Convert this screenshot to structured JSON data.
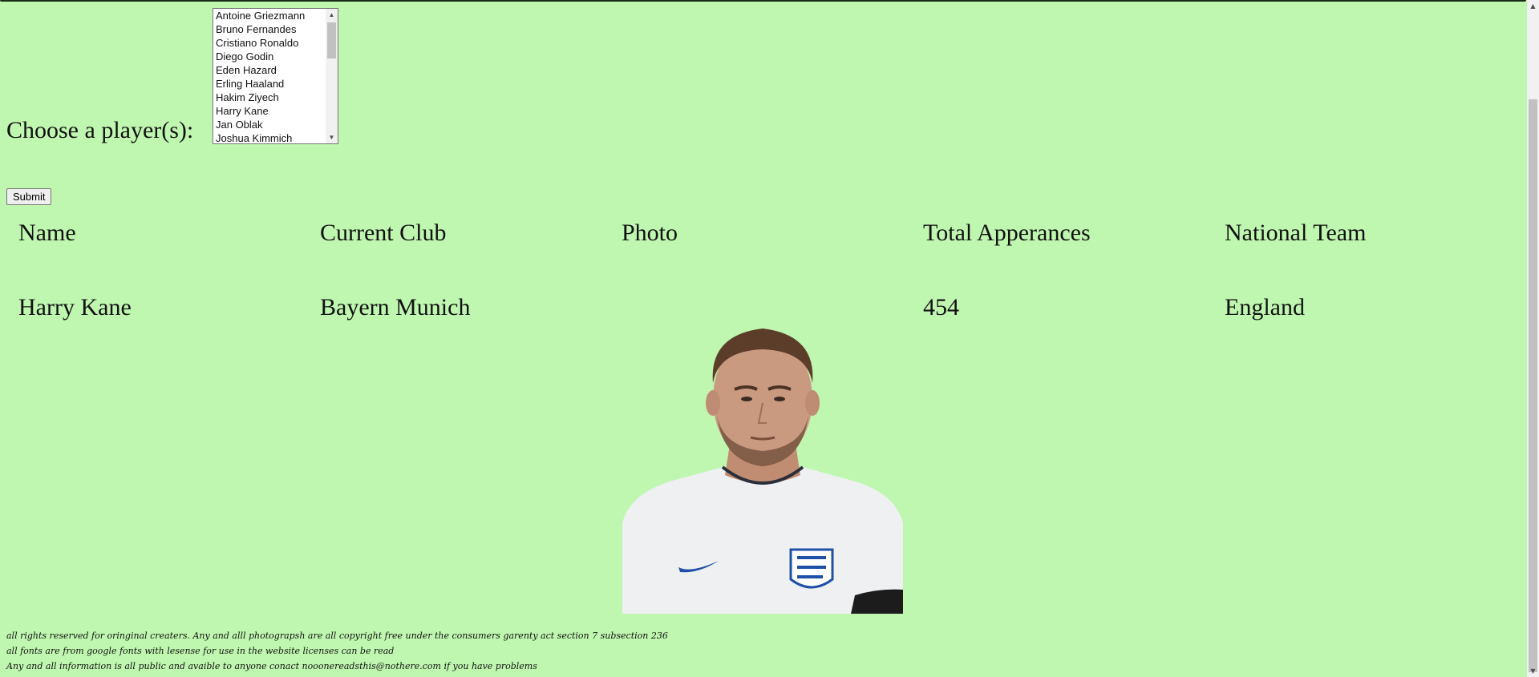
{
  "form": {
    "chooser_label": "Choose a player(s):",
    "players": [
      "Antoine Griezmann",
      "Bruno Fernandes",
      "Cristiano Ronaldo",
      "Diego Godin",
      "Eden Hazard",
      "Erling Haaland",
      "Hakim Ziyech",
      "Harry Kane",
      "Jan Oblak",
      "Joshua Kimmich"
    ],
    "submit_label": "Submit"
  },
  "table": {
    "headers": [
      "Name",
      "Current Club",
      "Photo",
      "Total Apperances",
      "National Team"
    ],
    "rows": [
      {
        "name": "Harry Kane",
        "club": "Bayern Munich",
        "appearances": "454",
        "national_team": "England",
        "photo_icon": "player-photo"
      }
    ]
  },
  "footer": {
    "lines": [
      "all rights reserved for oringinal creaters. Any and alll photograpsh are all copyright free under the consumers garenty act section 7 subsection 236",
      "all fonts are from google fonts with lesense for use in the website licenses can be read",
      "Any and all information is all public and avaible to anyone conact nooonereadsthis@nothere.com if you have problems"
    ]
  },
  "colors": {
    "background": "#c0f7b0",
    "kit_white": "#eef0f2",
    "skin": "#c99a80"
  }
}
